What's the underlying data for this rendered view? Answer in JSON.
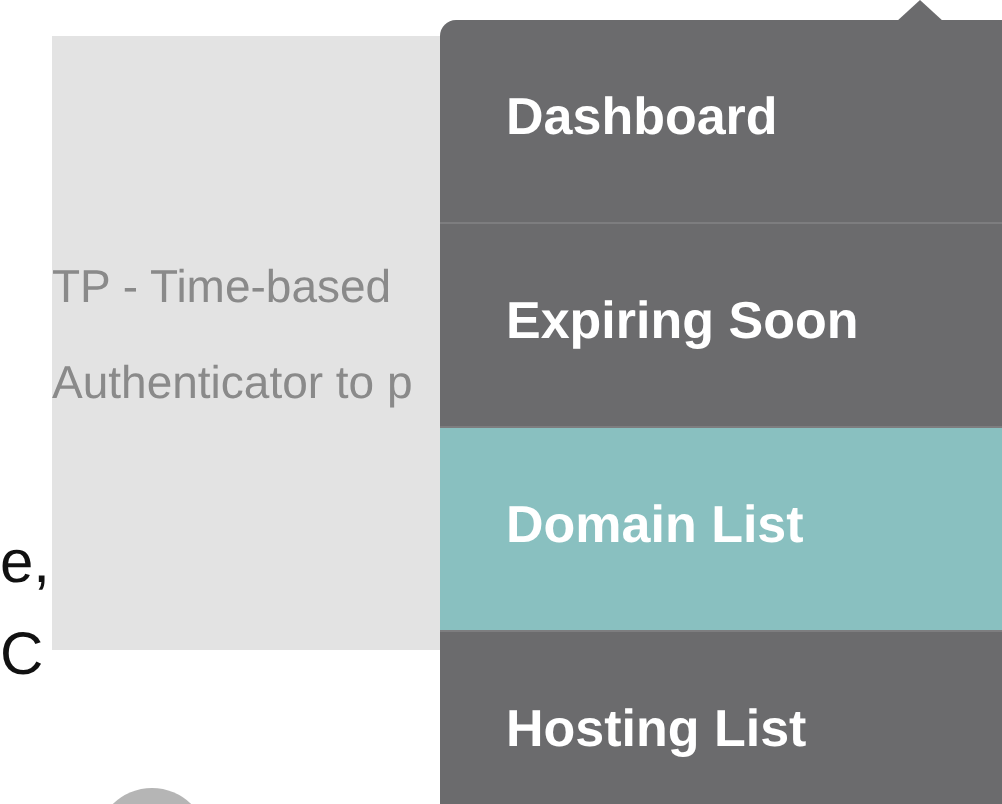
{
  "page_text": [
    "e,",
    "C"
  ],
  "overlay_panel": {
    "lines": [
      "TP - Time-based",
      "Authenticator to p"
    ]
  },
  "nav_menu": {
    "items": [
      {
        "label": "Dashboard",
        "selected": false
      },
      {
        "label": "Expiring Soon",
        "selected": false
      },
      {
        "label": "Domain List",
        "selected": true
      },
      {
        "label": "Hosting List",
        "selected": false
      }
    ]
  }
}
